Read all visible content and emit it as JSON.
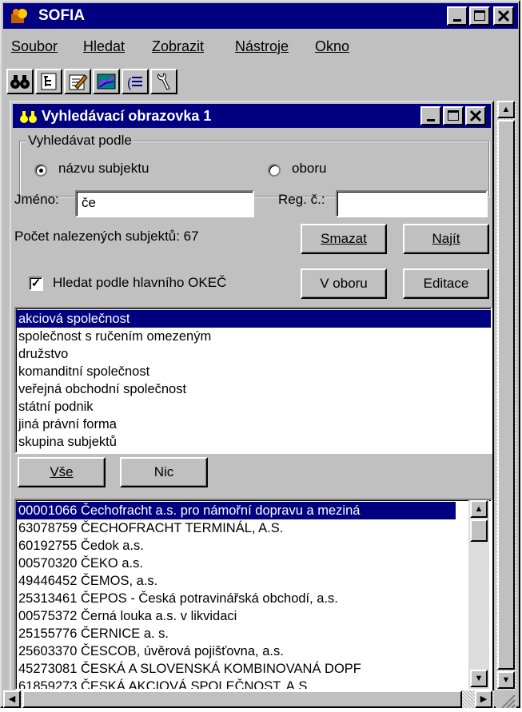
{
  "app": {
    "title": "SOFIA"
  },
  "menu": [
    {
      "label": "Soubor"
    },
    {
      "label": "Hledat"
    },
    {
      "label": "Zobrazit"
    },
    {
      "label": "Nástroje"
    },
    {
      "label": "Okno"
    }
  ],
  "toolbar": {
    "icons": [
      "binoculars-icon",
      "tree-icon",
      "edit-icon",
      "chart-icon",
      "list-icon",
      "tools-icon"
    ]
  },
  "child": {
    "title": "Vyhledávací obrazovka 1",
    "group_label": "Vyhledávat podle",
    "radio_name": "názvu subjektu",
    "radio_field": "oboru",
    "selected_radio": "name",
    "name_label": "Jméno:",
    "name_value": "če",
    "reg_label": "Reg. č.:",
    "reg_value": "",
    "count_text": "Počet nalezených subjektů: 67",
    "clear_button": "Smazat",
    "find_button": "Najít",
    "okec_label": "Hledat podle hlavního OKEČ",
    "okec_checked": true,
    "in_field_button": "V oboru",
    "edit_button": "Editace",
    "legal_forms": [
      "akciová společnost",
      "společnost s ručením omezeným",
      "družstvo",
      "komanditní společnost",
      "veřejná obchodní společnost",
      "státní podnik",
      "jiná právní forma",
      "skupina subjektů"
    ],
    "selected_form_index": 0,
    "all_button": "Vše",
    "none_button": "Nic",
    "results": [
      "00001066 Čechofracht a.s. pro námořní dopravu a meziná",
      "63078759 ČECHOFRACHT TERMINÁL, A.S.",
      "60192755 Čedok a.s.",
      "00570320 ČEKO a.s.",
      "49446452 ČEMOS, a.s.",
      "25313461 ČEPOS - Česká potravinářská obchodí, a.s.",
      "00575372 Černá louka a.s. v likvidaci",
      "25155776 ČERNICE a. s.",
      "25603370 ČESCOB,  úvěrová pojišťovna,  a.s.",
      "45273081 ČESKÁ A SLOVENSKÁ KOMBINOVANÁ DOPF",
      "61859273 ČESKÁ AKCIOVÁ SPOLEČNOST, A.S."
    ],
    "selected_result_index": 0
  },
  "colors": {
    "title_bar": "#000080",
    "face": "#c0c0c0",
    "selection": "#000080"
  }
}
